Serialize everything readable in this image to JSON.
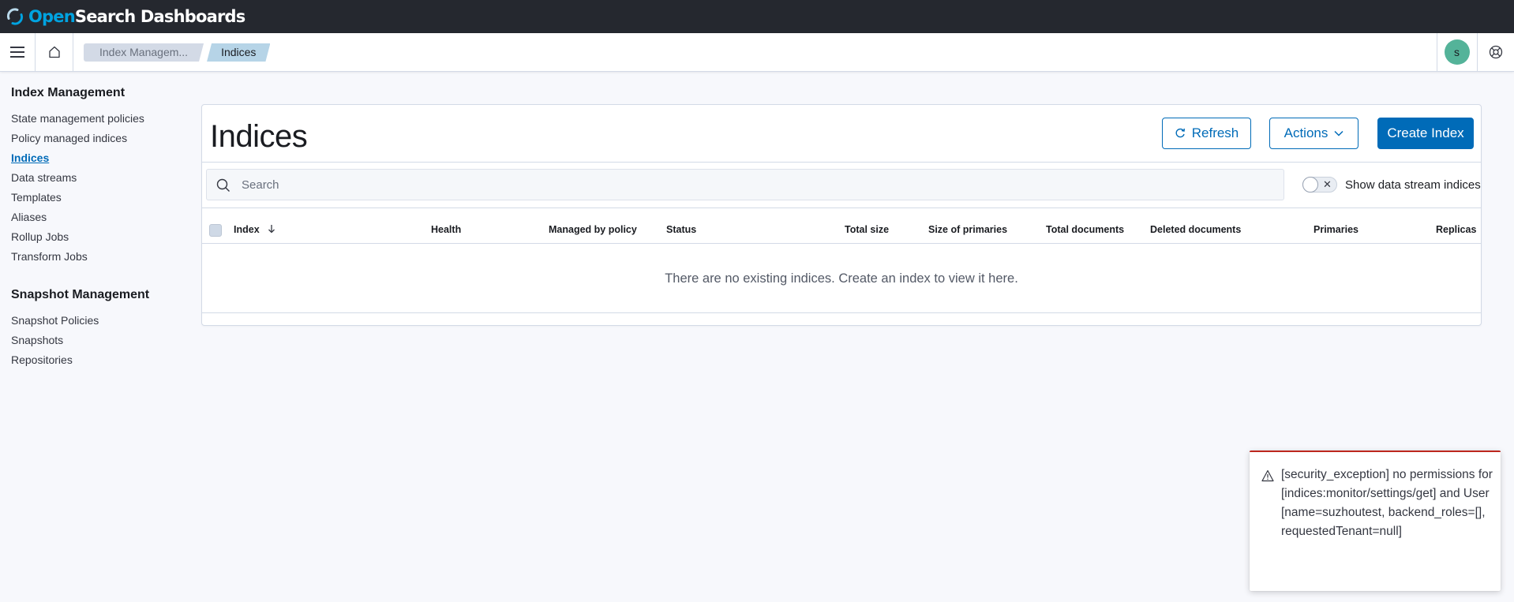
{
  "app": {
    "logo_open": "Open",
    "logo_rest": "Search Dashboards"
  },
  "breadcrumbs": [
    "Index Managem...",
    "Indices"
  ],
  "user": {
    "avatar_initial": "s",
    "avatar_color": "#54b399"
  },
  "sidebar": {
    "section1_title": "Index Management",
    "section1_items": [
      "State management policies",
      "Policy managed indices",
      "Indices",
      "Data streams",
      "Templates",
      "Aliases",
      "Rollup Jobs",
      "Transform Jobs"
    ],
    "active_item": "Indices",
    "section2_title": "Snapshot Management",
    "section2_items": [
      "Snapshot Policies",
      "Snapshots",
      "Repositories"
    ]
  },
  "main": {
    "title": "Indices",
    "refresh_label": "Refresh",
    "actions_label": "Actions",
    "create_label": "Create Index",
    "search_placeholder": "Search",
    "toggle_label": "Show data stream indices",
    "toggle_on": false,
    "columns": [
      "Index",
      "Health",
      "Managed by policy",
      "Status",
      "Total size",
      "Size of primaries",
      "Total documents",
      "Deleted documents",
      "Primaries",
      "Replicas"
    ],
    "sorted_column": "Index",
    "sort_direction": "descending",
    "empty_message": "There are no existing indices. Create an index to view it here."
  },
  "toast": {
    "message": "[security_exception] no permissions for [indices:monitor/settings/get] and User [name=suzhoutest, backend_roles=[], requestedTenant=null]",
    "status_color": "#bd271e"
  },
  "colors": {
    "accent": "#006bb8",
    "topbar": "#25282f",
    "brand": "#00a3e0"
  }
}
